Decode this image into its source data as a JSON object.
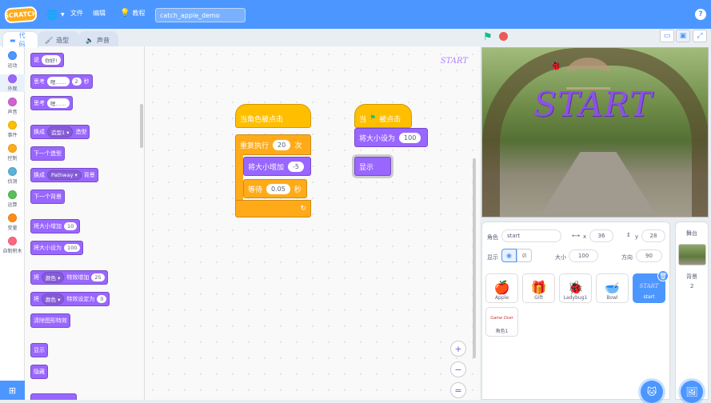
{
  "menubar": {
    "logo": "SCRATCH",
    "file": "文件",
    "edit": "编辑",
    "tutorials": "教程",
    "project_name": "catch_apple_demo",
    "help": "?"
  },
  "tabs": {
    "code": "代码",
    "costumes": "造型",
    "sounds": "声音"
  },
  "categories": [
    {
      "label": "运动",
      "color": "#4c97ff"
    },
    {
      "label": "外观",
      "color": "#9966ff"
    },
    {
      "label": "声音",
      "color": "#cf63cf"
    },
    {
      "label": "事件",
      "color": "#ffbf00"
    },
    {
      "label": "控制",
      "color": "#ffab19"
    },
    {
      "label": "侦测",
      "color": "#5cb1d6"
    },
    {
      "label": "运算",
      "color": "#59c059"
    },
    {
      "label": "变量",
      "color": "#ff8c1a"
    },
    {
      "label": "自制积木",
      "color": "#ff6680"
    }
  ],
  "palette": {
    "say_label": "说",
    "say_value": "你好!",
    "think_secs_label": "思考",
    "think_secs_value": "嗯……",
    "think_secs_num": "2",
    "think_secs_unit": "秒",
    "think_label": "思考",
    "think_value": "嗯……",
    "switch_costume_label": "换成",
    "switch_costume_value": "造型1",
    "switch_costume_suffix": "造型",
    "next_costume": "下一个造型",
    "switch_backdrop_label": "换成",
    "switch_backdrop_value": "Pathway",
    "switch_backdrop_suffix": "背景",
    "next_backdrop": "下一个背景",
    "change_size_label": "将大小增加",
    "change_size_value": "10",
    "set_size_label": "将大小设为",
    "set_size_value": "100",
    "change_effect_label": "将",
    "change_effect_dd": "颜色",
    "change_effect_mid": "特效增加",
    "change_effect_value": "25",
    "set_effect_label": "将",
    "set_effect_dd": "颜色",
    "set_effect_mid": "特效设定为",
    "set_effect_value": "0",
    "clear_effects": "清除图形特效",
    "show": "显示",
    "hide": "隐藏"
  },
  "workspace": {
    "watermark": "START",
    "script1": {
      "hat": "当角色被点击",
      "repeat_label": "重复执行",
      "repeat_value": "20",
      "repeat_unit": "次",
      "change_size_label": "将大小增加",
      "change_size_value": "-5",
      "wait_label": "等待",
      "wait_value": "0.05",
      "wait_unit": "秒"
    },
    "script2": {
      "hat_prefix": "当",
      "hat_suffix": "被点击",
      "set_size_label": "将大小设为",
      "set_size_value": "100",
      "show": "显示"
    },
    "zoom_in": "+",
    "zoom_out": "−",
    "zoom_reset": "="
  },
  "stage": {
    "title_text": "START"
  },
  "sprite_info": {
    "sprite_label": "角色",
    "sprite_name": "start",
    "x_label": "x",
    "x_value": "36",
    "y_label": "y",
    "y_value": "28",
    "show_label": "显示",
    "size_label": "大小",
    "size_value": "100",
    "direction_label": "方向",
    "direction_value": "90"
  },
  "sprites": [
    {
      "name": "Apple",
      "icon": "apple-icon"
    },
    {
      "name": "Gift",
      "icon": "gift-icon"
    },
    {
      "name": "Ladybug1",
      "icon": "ladybug-icon"
    },
    {
      "name": "Bowl",
      "icon": "bowl-icon"
    },
    {
      "name": "start",
      "icon": "start-text-icon",
      "selected": true
    },
    {
      "name": "角色1",
      "icon": "sprite1-icon"
    }
  ],
  "stage_panel": {
    "title": "舞台",
    "backdrop_label": "背景",
    "backdrop_count": "2"
  }
}
